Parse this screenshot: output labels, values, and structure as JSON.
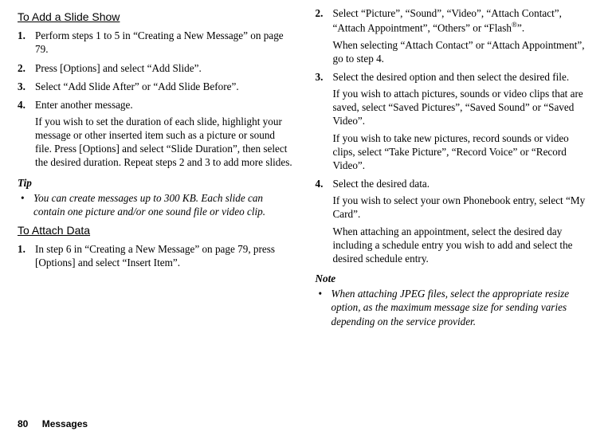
{
  "col_left": {
    "heading1": "To Add a Slide Show",
    "steps1": [
      {
        "num": "1.",
        "text": "Perform steps 1 to 5 in “Creating a New Message” on page 79."
      },
      {
        "num": "2.",
        "text": "Press [Options] and select “Add Slide”."
      },
      {
        "num": "3.",
        "text": "Select “Add Slide After” or “Add Slide Before”."
      },
      {
        "num": "4.",
        "text": "Enter another message.",
        "extra": "If you wish to set the duration of each slide, highlight your message or other inserted item such as a picture or sound file. Press [Options] and select “Slide Duration”, then select the desired duration. Repeat steps 2 and 3 to add more slides."
      }
    ],
    "tip_label": "Tip",
    "tip_items": [
      "You can create messages up to 300 KB. Each slide can contain one picture and/or one sound file or video clip."
    ],
    "heading2": "To Attach Data",
    "steps2": [
      {
        "num": "1.",
        "text": "In step 6 in “Creating a New Message” on page 79, press [Options] and select “Insert Item”."
      }
    ]
  },
  "col_right": {
    "steps_cont": [
      {
        "num": "2.",
        "text_pre": "Select “Picture”, “Sound”, “Video”, “Attach Contact”, “Attach Appointment”, “Others” or “Flash",
        "text_post": "”.",
        "extra": "When selecting “Attach Contact” or “Attach Appointment”, go to step 4."
      },
      {
        "num": "3.",
        "text": "Select the desired option and then select the desired file.",
        "extra1": "If you wish to attach pictures, sounds or video clips that are saved, select “Saved Pictures”, “Saved Sound” or “Saved Video”.",
        "extra2": "If you wish to take new pictures, record sounds or video clips, select “Take Picture”, “Record Voice” or “Record Video”."
      },
      {
        "num": "4.",
        "text": "Select the desired data.",
        "extra1": "If you wish to select your own Phonebook entry, select “My Card”.",
        "extra2": "When attaching an appointment, select the desired day including a schedule entry you wish to add and select the desired schedule entry."
      }
    ],
    "note_label": "Note",
    "note_items": [
      "When attaching JPEG files, select the appropriate resize option, as the maximum message size for sending varies depending on the service provider."
    ]
  },
  "footer": {
    "page_num": "80",
    "chapter": "Messages"
  },
  "superscript": "®"
}
